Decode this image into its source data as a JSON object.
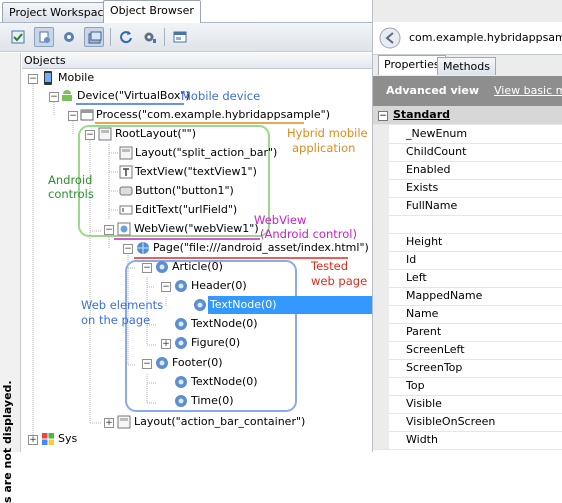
{
  "tabs": {
    "project_workspace": "Project Workspace",
    "object_browser": "Object Browser"
  },
  "toolbar": {
    "icons": [
      "show-objects-icon",
      "show-hidden-icon",
      "settings-gear-icon",
      "object-spy-icon",
      "refresh-icon",
      "customize-gear-icon",
      "stored-objects-icon"
    ]
  },
  "objects_header": "Objects",
  "vertical_notice": "...Objects that are not displayed.",
  "vertical_notice_visible": "s are not displayed.",
  "tree": {
    "mobile": "Mobile",
    "device": "Device(\"VirtualBox\")",
    "process": "Process(\"com.example.hybridappsample\")",
    "root_layout": "RootLayout(\"\")",
    "layout_split": "Layout(\"split_action_bar\")",
    "textview1": "TextView(\"textView1\")",
    "button1": "Button(\"button1\")",
    "edittext": "EditText(\"urlField\")",
    "webview": "WebView(\"webView1\")",
    "page": "Page(\"file:///android_asset/index.html\")",
    "article": "Article(0)",
    "header": "Header(0)",
    "textnode_selected": "TextNode(0)",
    "textnode_a": "TextNode(0)",
    "figure": "Figure(0)",
    "footer": "Footer(0)",
    "textnode_b": "TextNode(0)",
    "time": "Time(0)",
    "layout_container": "Layout(\"action_bar_container\")",
    "sys": "Sys"
  },
  "annotations": {
    "mobile_device": "Mobile device",
    "hybrid_line1": "Hybrid mobile",
    "hybrid_line2": "application",
    "android_line1": "Android",
    "android_line2": "controls",
    "webview_line1": "WebView",
    "webview_line2": "(Android control)",
    "tested_line1": "Tested",
    "tested_line2": "web page",
    "webel_line1": "Web elements",
    "webel_line2": "on the page"
  },
  "colors": {
    "blue_note": "#3a6ee0",
    "orange_note": "#e08a1a",
    "green_note": "#2e8f2e",
    "magenta_note": "#c81ec8",
    "red_note": "#e02a1a",
    "selection": "#3399ff",
    "blue_frame": "#8aaaf0",
    "green_frame": "#9bd88b"
  },
  "right": {
    "object_path": "com.example.hybridappsample\"",
    "properties_tab": "Properties",
    "methods_tab": "Methods",
    "advanced_view": "Advanced view",
    "basic_link": "View basic mem",
    "standard_group": "Standard",
    "properties": [
      "_NewEnum",
      "ChildCount",
      "Enabled",
      "Exists",
      "FullName",
      "",
      "Height",
      "Id",
      "Left",
      "MappedName",
      "Name",
      "Parent",
      "ScreenLeft",
      "ScreenTop",
      "Top",
      "Visible",
      "VisibleOnScreen",
      "Width"
    ]
  }
}
